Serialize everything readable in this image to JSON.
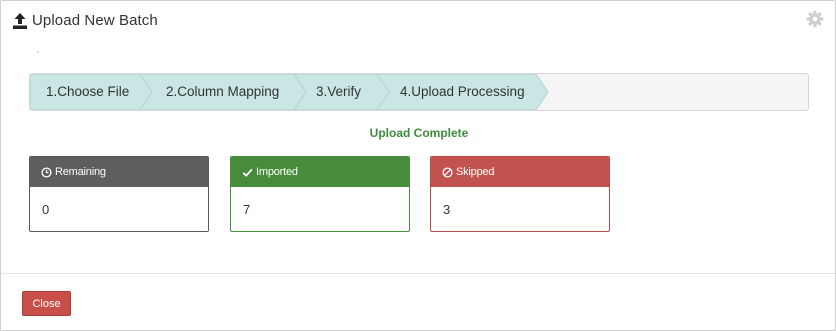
{
  "header": {
    "title": "Upload New Batch",
    "icon": "upload-icon",
    "settings_icon": "gear-icon"
  },
  "wizard": {
    "steps": [
      {
        "label": "1.Choose File",
        "state": "completed"
      },
      {
        "label": "2.Column Mapping",
        "state": "completed"
      },
      {
        "label": "3.Verify",
        "state": "completed"
      },
      {
        "label": "4.Upload Processing",
        "state": "active"
      }
    ],
    "colors": {
      "step_fill": "#c9e6e4",
      "step_border": "#b7d3d1",
      "track_bg": "#f4f4f4"
    }
  },
  "status": {
    "text": "Upload Complete",
    "color": "#3d8b3d"
  },
  "stats": [
    {
      "title": "Remaining",
      "value": "0",
      "icon": "clock-icon",
      "color": "#5e5e5e"
    },
    {
      "title": "Imported",
      "value": "7",
      "icon": "check-icon",
      "color": "#478c3b"
    },
    {
      "title": "Skipped",
      "value": "3",
      "icon": "ban-icon",
      "color": "#c2524e"
    }
  ],
  "footer": {
    "close_label": "Close",
    "close_color": "#c94f4b"
  }
}
